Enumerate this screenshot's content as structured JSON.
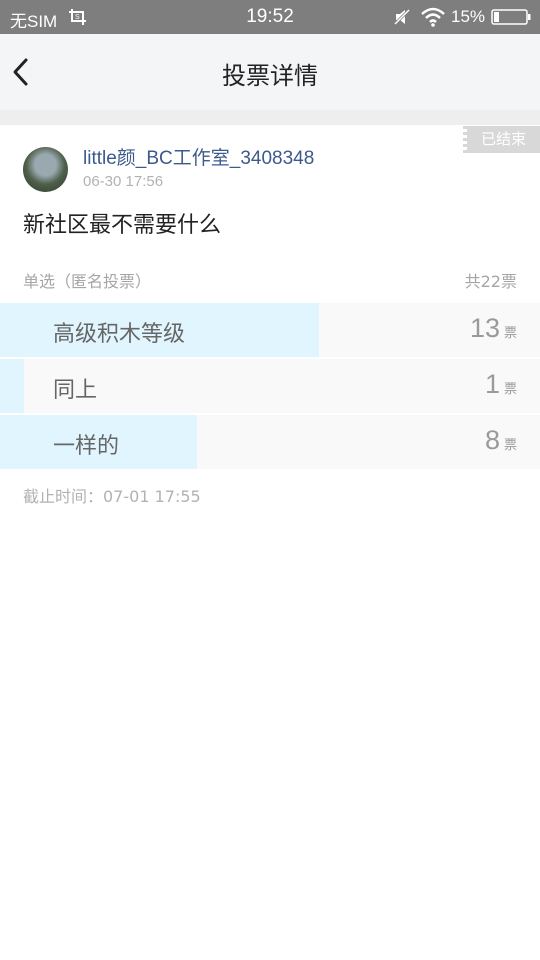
{
  "status_bar": {
    "carrier": "无SIM",
    "time": "19:52",
    "battery": "15%",
    "icons": [
      "screenshot-icon",
      "mute-icon",
      "wifi-icon",
      "battery-icon"
    ]
  },
  "nav": {
    "title": "投票详情",
    "back_icon": "chevron-left-icon"
  },
  "post": {
    "status_tag": "已结束",
    "username": "little颜_BC工作室_3408348",
    "time": "06-30 17:56",
    "question": "新社区最不需要什么"
  },
  "poll": {
    "mode": "单选（匿名投票）",
    "total": "共22票",
    "unit": "票",
    "options": [
      {
        "label": "高级积木等级",
        "votes": "13",
        "fraction": 0.59
      },
      {
        "label": "同上",
        "votes": "1",
        "fraction": 0.045
      },
      {
        "label": "一样的",
        "votes": "8",
        "fraction": 0.364
      }
    ],
    "deadline": "截止时间：07-01 17:55"
  },
  "colors": {
    "accent_fill": "#e0f5fd",
    "username": "#3d5a8c",
    "status_bar": "#7e7e7e"
  }
}
